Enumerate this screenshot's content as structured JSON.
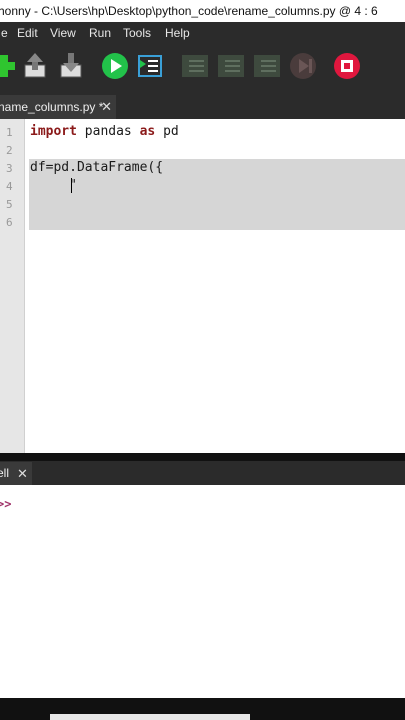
{
  "window": {
    "title": "honny  -  C:\\Users\\hp\\Desktop\\python_code\\rename_columns.py  @  4 : 6"
  },
  "menu": [
    "e",
    "Edit",
    "View",
    "Run",
    "Tools",
    "Help"
  ],
  "toolbar": {
    "icons": [
      "new-file-icon",
      "open-file-icon",
      "save-file-icon",
      "run-icon",
      "debug-icon",
      "step-over-icon",
      "step-into-icon",
      "step-out-icon",
      "resume-icon",
      "stop-icon"
    ]
  },
  "editor_tab": {
    "label": "name_columns.py *",
    "close": "✕"
  },
  "editor": {
    "line_numbers": [
      "1",
      "2",
      "3",
      "4",
      "5",
      "6"
    ],
    "lines": {
      "l1_kw1": "import",
      "l1_mid": " pandas ",
      "l1_kw2": "as",
      "l1_end": " pd",
      "l3": "df=pd.DataFrame({",
      "l4": "     \""
    }
  },
  "shell_tab": {
    "label": "ell",
    "close": "✕"
  },
  "shell": {
    "prompt": ">>"
  },
  "colors": {
    "stop": "#e0173e",
    "run": "#22c24a",
    "new": "#2fc52f",
    "keyword": "#8b1a1a"
  }
}
